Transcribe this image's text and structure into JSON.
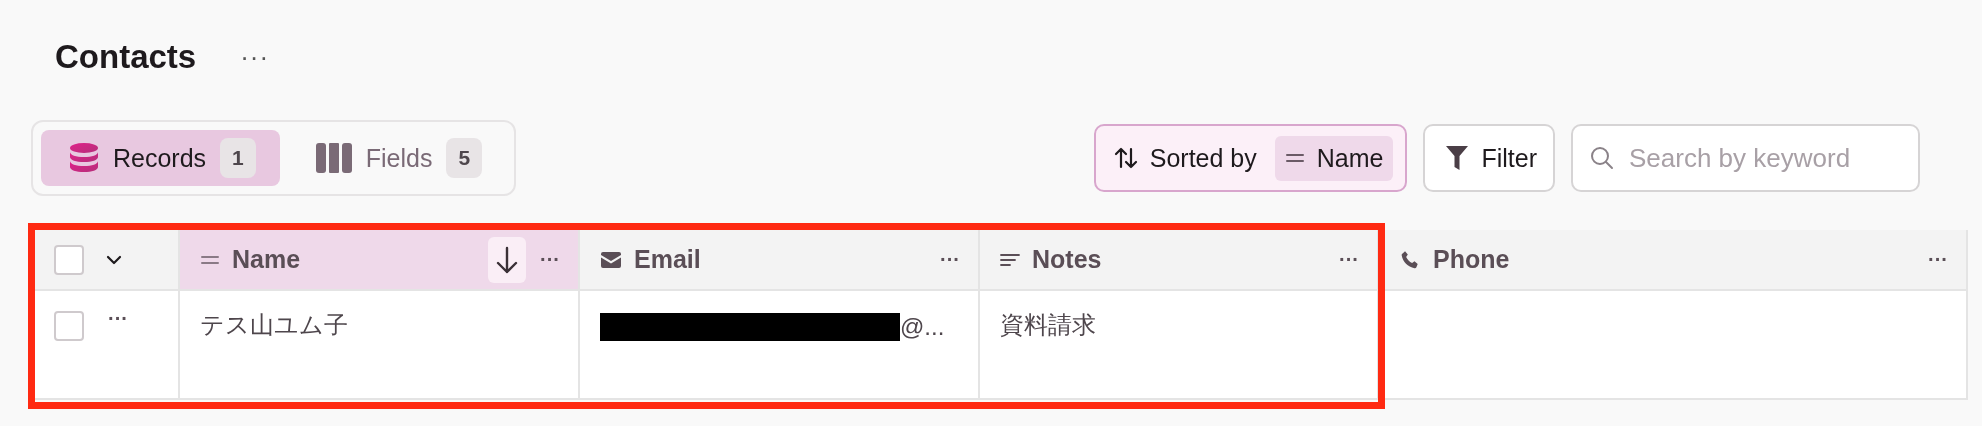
{
  "title": "Contacts",
  "title_menu": "···",
  "view_tabs": [
    {
      "kind": "records",
      "label": "Records",
      "count": "1",
      "selected": true
    },
    {
      "kind": "fields",
      "label": "Fields",
      "count": "5",
      "selected": false
    }
  ],
  "sort": {
    "label": "Sorted by",
    "field": "Name"
  },
  "filter": {
    "label": "Filter"
  },
  "search": {
    "placeholder": "Search by keyword"
  },
  "table": {
    "select_all_checked": false,
    "columns": [
      {
        "kind": "text",
        "name": "Name",
        "sorted": true,
        "menu": "···"
      },
      {
        "kind": "email",
        "name": "Email",
        "sorted": false,
        "menu": "···"
      },
      {
        "kind": "notes",
        "name": "Notes",
        "sorted": false,
        "menu": "···"
      },
      {
        "kind": "phone",
        "name": "Phone",
        "sorted": false,
        "menu": "···"
      }
    ],
    "rows": [
      {
        "checked": false,
        "menu": "···",
        "cells": [
          {
            "text": "テス山ユム子",
            "redacted": false
          },
          {
            "text": "@...",
            "redacted": true
          },
          {
            "text": "資料請求",
            "redacted": false
          }
        ]
      }
    ]
  },
  "annotation": {
    "kind": "frame",
    "color": "#ff2a12"
  }
}
